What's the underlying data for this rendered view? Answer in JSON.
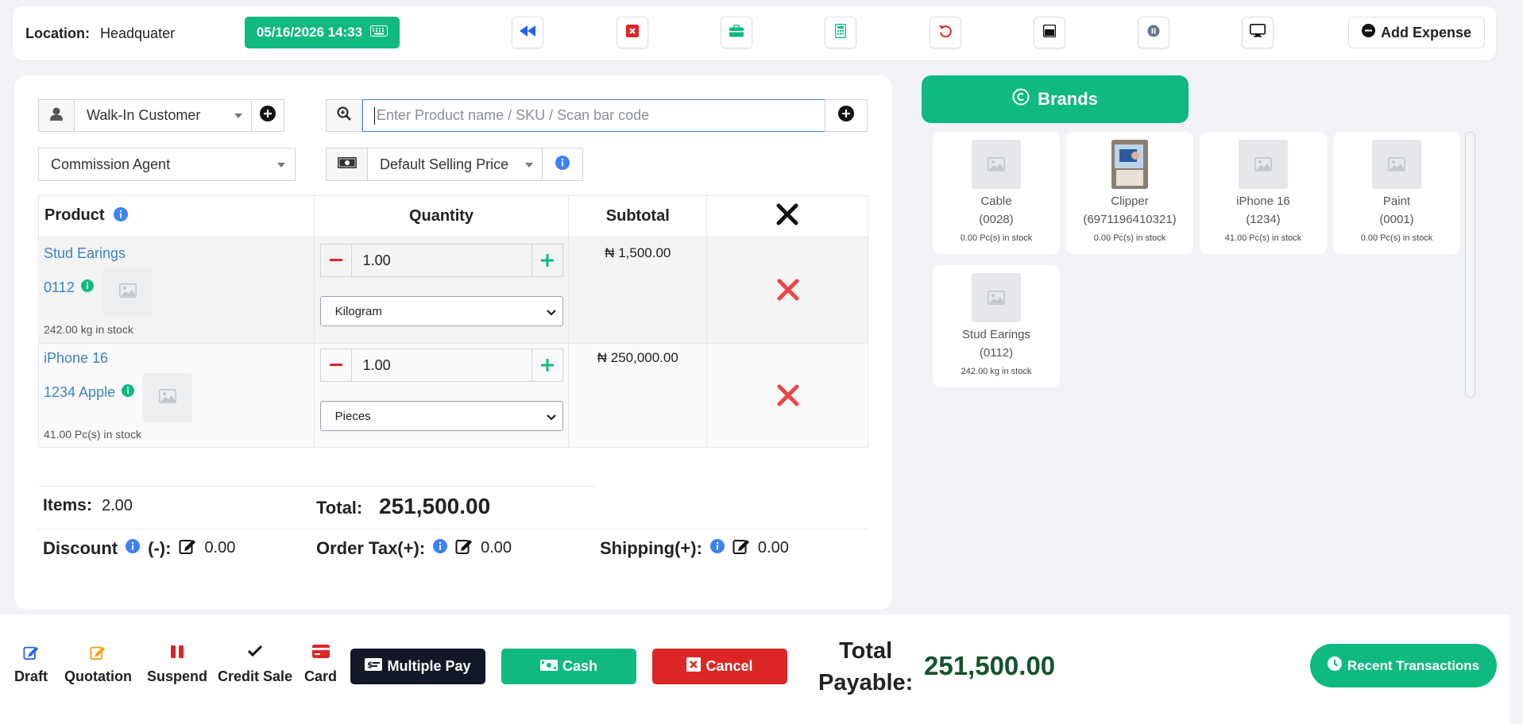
{
  "topbar": {
    "location_label": "Location:",
    "location_value": "Headquater",
    "datetime": "05/16/2026 14:33",
    "icons": [
      "backward-icon",
      "close-window-icon",
      "briefcase-icon",
      "calculator-icon",
      "undo-icon",
      "window-icon",
      "pause-icon",
      "monitor-icon"
    ],
    "add_expense_label": "Add Expense"
  },
  "form": {
    "customer": "Walk-In Customer",
    "search_placeholder": "Enter Product name / SKU / Scan bar code",
    "commission_agent": "Commission Agent",
    "price_group": "Default Selling Price"
  },
  "cart": {
    "headers": {
      "product": "Product",
      "quantity": "Quantity",
      "subtotal": "Subtotal"
    },
    "rows": [
      {
        "name": "Stud Earings",
        "sku": "0112",
        "stock": "242.00 kg in stock",
        "qty": "1.00",
        "unit": "Kilogram",
        "subtotal": "₦ 1,500.00"
      },
      {
        "name": "iPhone 16",
        "sku": "1234 Apple",
        "stock": "41.00 Pc(s) in stock",
        "qty": "1.00",
        "unit": "Pieces",
        "subtotal": "₦ 250,000.00"
      }
    ]
  },
  "totals": {
    "items_label": "Items:",
    "items_value": "2.00",
    "total_label": "Total:",
    "total_value": "251,500.00",
    "discount_label": "Discount",
    "discount_sign": "(-):",
    "discount_value": "0.00",
    "tax_label": "Order Tax(+):",
    "tax_value": "0.00",
    "shipping_label": "Shipping(+):",
    "shipping_value": "0.00"
  },
  "brands": {
    "button_label": "Brands",
    "products": [
      {
        "name": "Cable",
        "sku": "(0028)",
        "stock": "0.00 Pc(s) in stock"
      },
      {
        "name": "Clipper",
        "sku": "(6971196410321)",
        "stock": "0.00 Pc(s) in stock"
      },
      {
        "name": "iPhone 16",
        "sku": "(1234)",
        "stock": "41.00 Pc(s) in stock"
      },
      {
        "name": "Paint",
        "sku": "(0001)",
        "stock": "0.00 Pc(s) in stock"
      },
      {
        "name": "Stud Earings",
        "sku": "(0112)",
        "stock": "242.00 kg in stock"
      }
    ]
  },
  "bottom": {
    "draft": "Draft",
    "quotation": "Quotation",
    "suspend": "Suspend",
    "credit_sale": "Credit Sale",
    "card": "Card",
    "multiple_pay": "Multiple Pay",
    "cash": "Cash",
    "cancel": "Cancel",
    "total_payable_line1": "Total",
    "total_payable_line2": "Payable:",
    "total_payable_value": "251,500.00",
    "recent_transactions": "Recent Transactions"
  },
  "colors": {
    "accent": "#10b981",
    "danger": "#dc2626",
    "dark": "#111827",
    "link": "#3b82c4",
    "info": "#3b82f6"
  }
}
